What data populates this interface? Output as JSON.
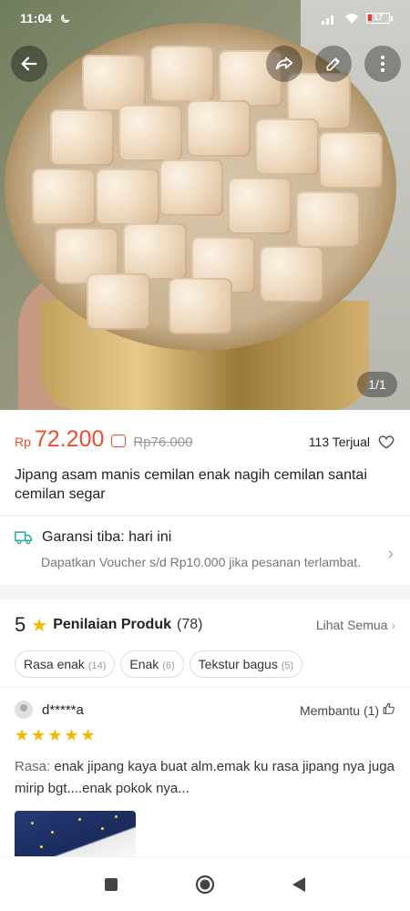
{
  "status_bar": {
    "time": "11:04",
    "battery": "17"
  },
  "gallery": {
    "counter": "1/1"
  },
  "product": {
    "currency": "Rp",
    "price": "72.200",
    "old_price": "Rp76.000",
    "sold": "113 Terjual",
    "title": "Jipang asam manis cemilan enak nagih cemilan santai cemilan segar"
  },
  "shipping": {
    "guarantee": "Garansi tiba: hari ini",
    "voucher": "Dapatkan Voucher s/d Rp10.000 jika pesanan terlambat."
  },
  "reviews": {
    "rating": "5",
    "label": "Penilaian Produk",
    "count": "(78)",
    "see_all": "Lihat Semua",
    "tags": [
      {
        "label": "Rasa enak",
        "count": "(14)"
      },
      {
        "label": "Enak",
        "count": "(6)"
      },
      {
        "label": "Tekstur bagus",
        "count": "(5)"
      }
    ],
    "review": {
      "username": "d*****a",
      "helpful": "Membantu (1)",
      "stars": "★★★★★",
      "text_label": "Rasa:",
      "text": " enak jipang kaya buat alm.emak ku rasa jipang nya juga mirip bgt....enak pokok nya..."
    }
  },
  "colors": {
    "accent": "#ee4d2d",
    "star": "#f5b800"
  }
}
